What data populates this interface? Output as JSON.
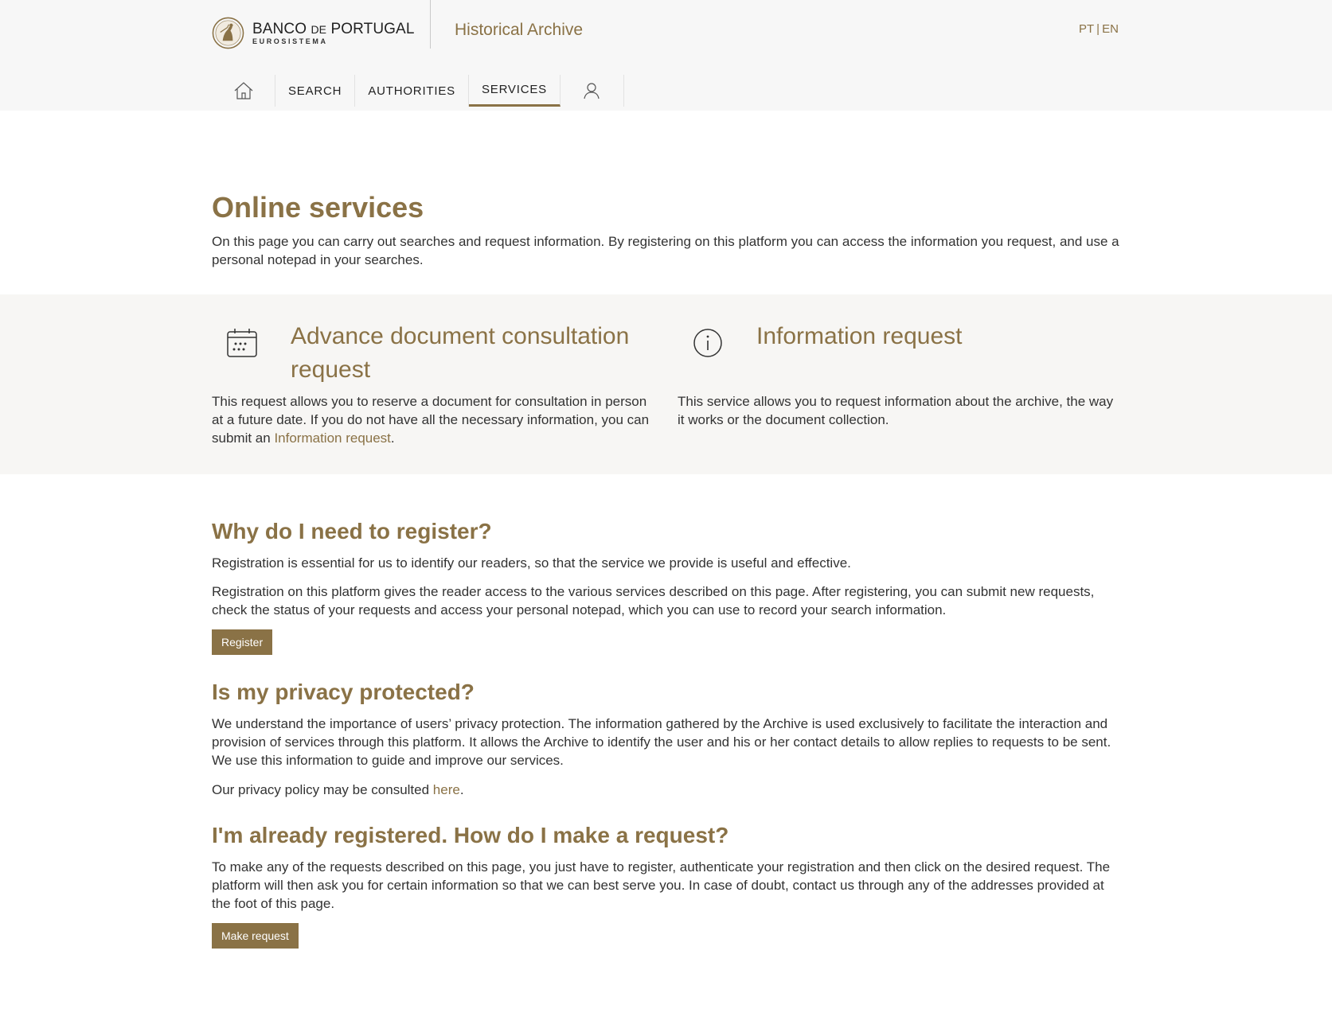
{
  "header": {
    "logo_name_1": "BANCO",
    "logo_name_2": "DE",
    "logo_name_3": "PORTUGAL",
    "logo_sub": "EUROSISTEMA",
    "archive_title": "Historical Archive",
    "lang_pt": "PT",
    "lang_sep": "|",
    "lang_en": "EN"
  },
  "nav": {
    "home_icon": "home-icon",
    "items": [
      {
        "label": "SEARCH"
      },
      {
        "label": "AUTHORITIES"
      },
      {
        "label": "SERVICES",
        "active": true
      }
    ],
    "user_icon": "user-icon"
  },
  "intro": {
    "title": "Online services",
    "text": "On this page you can carry out searches and request information. By registering on this platform you can access the information you request, and use a personal notepad in your searches."
  },
  "services": [
    {
      "icon": "calendar-icon",
      "title": "Advance document consultation request",
      "desc_before": "This request allows you to reserve a document for consultation in person at a future date. If you do not have all the necessary information, you can submit an ",
      "desc_link": "Information request",
      "desc_after": "."
    },
    {
      "icon": "info-icon",
      "title": "Information request",
      "desc": "This service allows you to request information about the archive, the way it works or the document collection."
    }
  ],
  "register_section": {
    "title": "Why do I need to register?",
    "p1": "Registration is essential for us to identify our readers, so that the service we provide is useful and effective.",
    "p2": "Registration on this platform gives the reader access to the various services described on this page. After registering, you can submit new requests, check the status of your requests and access your personal notepad, which you can use to record your search information.",
    "button": "Register"
  },
  "privacy_section": {
    "title": "Is my privacy protected?",
    "p1": "We understand the importance of users’ privacy protection. The information gathered by the Archive is used exclusively to facilitate the interaction and provision of services through this platform. It allows the Archive to identify the user and his or her contact details to allow replies to requests to be sent. We use this information to guide and improve our services.",
    "p2_before": "Our privacy policy may be consulted ",
    "p2_link": "here",
    "p2_after": "."
  },
  "request_section": {
    "title": "I'm already registered. How do I make a request?",
    "p1": "To make any of the requests described on this page, you just have to register, authenticate your registration and then click on the desired request. The platform will then ask you for certain information so that we can best serve you. In case of doubt, contact us through any of the addresses provided at the foot of this page.",
    "button": "Make request"
  },
  "colors": {
    "accent": "#8a7246",
    "header_bg": "#f7f7f7",
    "band_bg": "#f7f6f4",
    "text": "#333333"
  }
}
